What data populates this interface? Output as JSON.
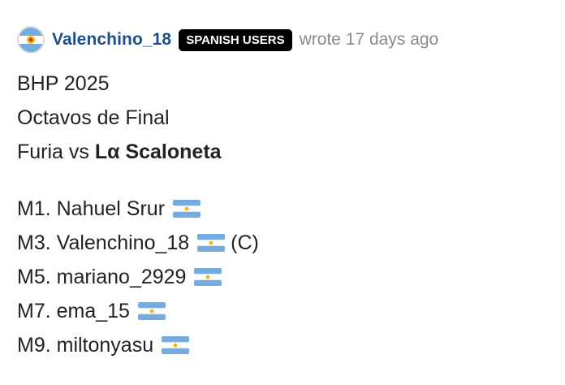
{
  "post": {
    "author": "Valenchino_18",
    "badge": "SPANISH USERS",
    "meta": "wrote 17 days ago",
    "avatar_icon": "argentina-flag-emblem-icon",
    "lines": {
      "l1": "BHP 2025",
      "l2": "Octavos de Final",
      "l3_prefix": "Furia vs ",
      "l3_bold": "Lα Scaloneta"
    },
    "roster": [
      {
        "text": "M1. Nahuel Srur",
        "flag": "argentina-flag-icon",
        "suffix": ""
      },
      {
        "text": "M3. Valenchino_18",
        "flag": "argentina-flag-icon",
        "suffix": "(C)"
      },
      {
        "text": "M5. mariano_2929",
        "flag": "argentina-flag-icon",
        "suffix": ""
      },
      {
        "text": "M7. ema_15",
        "flag": "argentina-flag-icon",
        "suffix": ""
      },
      {
        "text": "M9. miltonyasu",
        "flag": "argentina-flag-icon",
        "suffix": ""
      }
    ]
  },
  "colors": {
    "username": "#1d4e8f",
    "badge_bg": "#000000",
    "meta": "#8a8a8a",
    "flag_blue": "#74acdf",
    "flag_sun": "#f6b40e"
  }
}
